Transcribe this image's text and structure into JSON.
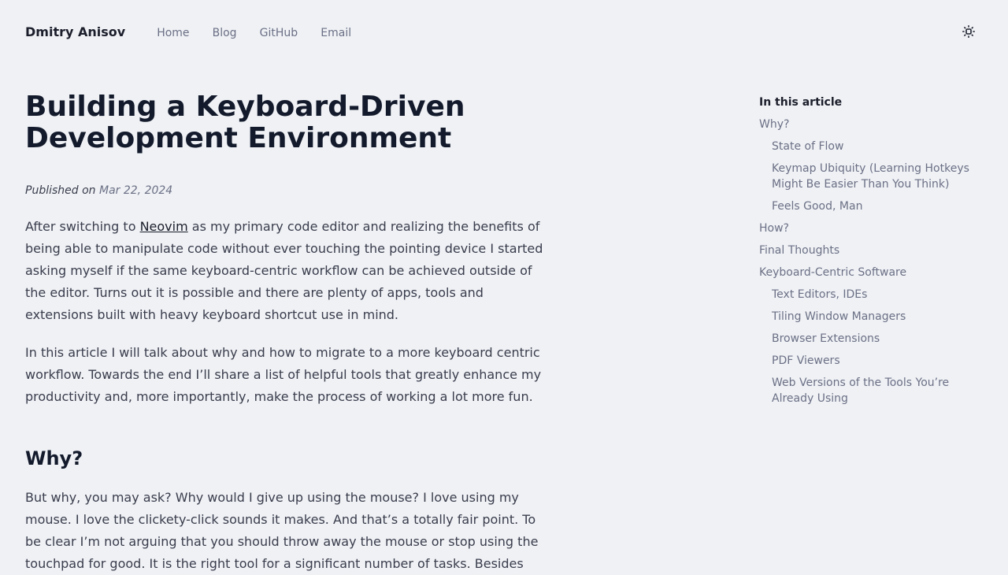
{
  "header": {
    "site_name": "Dmitry Anisov",
    "nav": [
      {
        "label": "Home"
      },
      {
        "label": "Blog"
      },
      {
        "label": "GitHub"
      },
      {
        "label": "Email"
      }
    ],
    "theme_toggle_icon": "sun-icon"
  },
  "article": {
    "title": "Building a Keyboard-Driven Development Environment",
    "published_label": "Published on",
    "published_date": "Mar 22, 2024",
    "intro_p1_before_link": "After switching to ",
    "intro_p1_link": "Neovim",
    "intro_p1_after_link": " as my primary code editor and realizing the benefits of being able to manipulate code without ever touching the pointing device I started asking myself if the same keyboard-centric workflow can be achieved outside of the editor. Turns out it is possible and there are plenty of apps, tools and extensions built with heavy keyboard shortcut use in mind.",
    "intro_p2": "In this article I will talk about why and how to migrate to a more keyboard centric workflow. Towards the end I’ll share a list of helpful tools that greatly enhance my productivity and, more importantly, make the process of working a lot more fun.",
    "section_why_heading": "Why?",
    "section_why_p1": "But why, you may ask? Why would I give up using the mouse? I love using my mouse. I love the clickety-click sounds it makes. And that’s a totally fair point. To be clear I’m not arguing that you should throw away the mouse or stop using the touchpad for good. It is the right tool for a significant number of tasks. Besides"
  },
  "toc": {
    "title": "In this article",
    "items": [
      {
        "label": "Why?",
        "level": 1
      },
      {
        "label": "State of Flow",
        "level": 2
      },
      {
        "label": "Keymap Ubiquity (Learning Hotkeys Might Be Easier Than You Think)",
        "level": 2
      },
      {
        "label": "Feels Good, Man",
        "level": 2
      },
      {
        "label": "How?",
        "level": 1
      },
      {
        "label": "Final Thoughts",
        "level": 1
      },
      {
        "label": "Keyboard-Centric Software",
        "level": 1
      },
      {
        "label": "Text Editors, IDEs",
        "level": 2
      },
      {
        "label": "Tiling Window Managers",
        "level": 2
      },
      {
        "label": "Browser Extensions",
        "level": 2
      },
      {
        "label": "PDF Viewers",
        "level": 2
      },
      {
        "label": "Web Versions of the Tools You’re Already Using",
        "level": 2
      }
    ]
  }
}
